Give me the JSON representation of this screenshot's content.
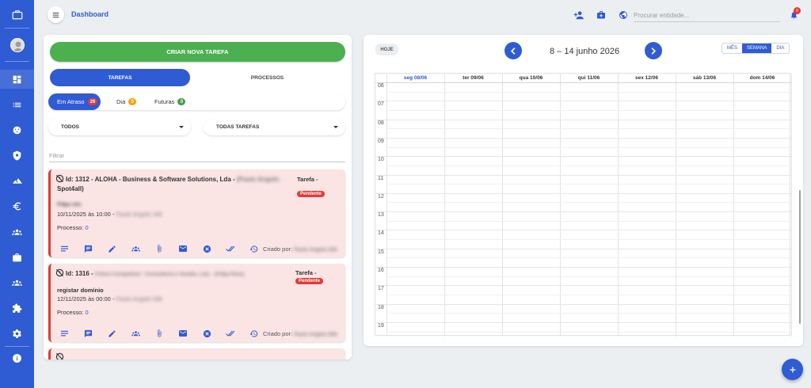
{
  "sidebar": {
    "items": [
      {
        "icon": "briefcase-icon",
        "name": "sidebar-item-briefcase"
      },
      {
        "icon": "avatar",
        "name": "sidebar-item-profile"
      },
      {
        "icon": "dashboard-icon",
        "name": "sidebar-item-dashboard"
      },
      {
        "icon": "list-icon",
        "name": "sidebar-item-list"
      },
      {
        "icon": "support-icon",
        "name": "sidebar-item-support"
      },
      {
        "icon": "shield-icon",
        "name": "sidebar-item-security"
      },
      {
        "icon": "landscape-icon",
        "name": "sidebar-item-chart"
      },
      {
        "icon": "euro-icon",
        "name": "sidebar-item-finance"
      },
      {
        "icon": "people-icon",
        "name": "sidebar-item-people"
      },
      {
        "icon": "business-icon",
        "name": "sidebar-item-business"
      },
      {
        "icon": "group-icon",
        "name": "sidebar-item-groups"
      },
      {
        "icon": "puzzle-icon",
        "name": "sidebar-item-extensions"
      },
      {
        "icon": "gear-icon",
        "name": "sidebar-item-settings"
      },
      {
        "icon": "info-icon",
        "name": "sidebar-item-info"
      }
    ]
  },
  "header": {
    "title": "Dashboard",
    "search_placeholder": "Procurar entidade...",
    "notification_count": "0"
  },
  "tasks": {
    "create_label": "CRIAR NOVA TAREFA",
    "tabs": [
      "TAREFAS",
      "PROCESSOS"
    ],
    "chips": [
      {
        "label": "Em Atraso",
        "count": "26",
        "color": "#e53935"
      },
      {
        "label": "Dia",
        "count": "0",
        "color": "#ffa000"
      },
      {
        "label": "Futuras",
        "count": "0",
        "color": "#43a047"
      }
    ],
    "dropdowns": [
      "TODOS",
      "TODAS TAREFAS"
    ],
    "filter_placeholder": "Filtrar",
    "cards": [
      {
        "title": "Id: 1312 - ALOHA - Business & Software Solutions, Lda -",
        "title_blur": "(Paulo Angelo",
        "title_line2": "Spot4all)",
        "type": "Tarefa -",
        "status": "Pendente",
        "subject_blur": "Filipe reis",
        "datetime": "10/11/2025 às 10:00 -",
        "datetime_blur": "Paulo Angelo Silk",
        "processo_label": "Processo:",
        "processo_value": "0",
        "created_label": "Criado por:",
        "created_blur": "Paulo Angelo Silk"
      },
      {
        "title": "Id: 1316 -",
        "title_blur": "Futuro Competivel - Consultoria e Gestão, Lda. - (Filipa Reis)",
        "type": "Tarefa -",
        "status": "Pendente",
        "subject": "registar domínio",
        "datetime": "12/11/2025 às 00:00 -",
        "datetime_blur": "Paulo Angelo Silk",
        "processo_label": "Processo:",
        "processo_value": "0",
        "created_label": "Criado por:",
        "created_blur": "Paulo Angelo Silk"
      }
    ]
  },
  "calendar": {
    "today_label": "HOJE",
    "range": "8 – 14 junho 2026",
    "views": [
      "MÊS",
      "SEMANA",
      "DIA"
    ],
    "active_view": "SEMANA",
    "days": [
      "seg 08/06",
      "ter 09/06",
      "qua 10/06",
      "qui 11/06",
      "sex 12/06",
      "sáb 13/06",
      "dom 14/06"
    ],
    "today_index": 0,
    "hours": [
      "06",
      "07",
      "08",
      "09",
      "10",
      "11",
      "12",
      "13",
      "14",
      "15",
      "16",
      "17",
      "18",
      "19"
    ]
  },
  "colors": {
    "primary": "#2f5bd3",
    "create": "#4caf50",
    "danger": "#e53935",
    "card_bg": "#fbe4e4"
  }
}
